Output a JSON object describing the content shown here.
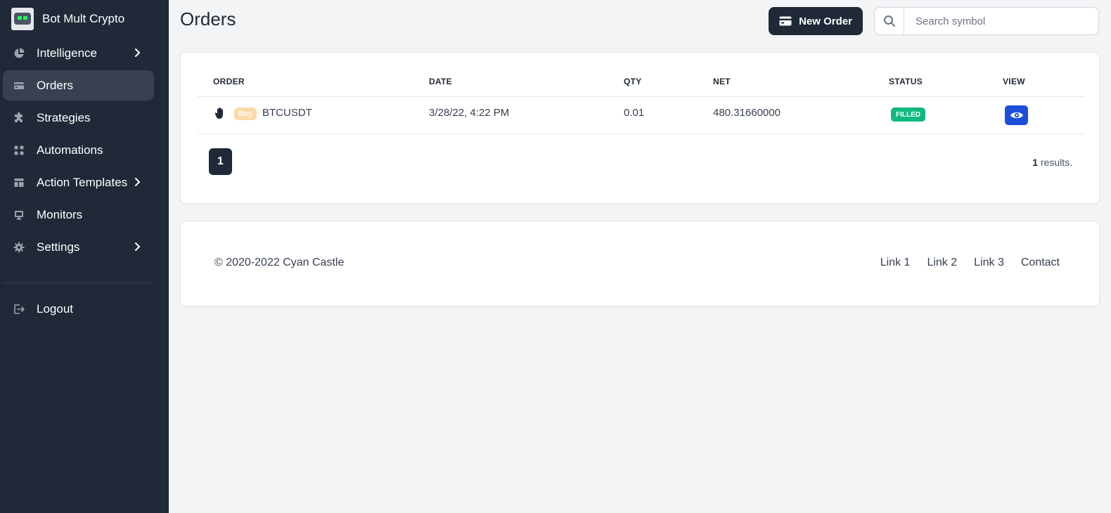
{
  "app": {
    "title": "Bot Mult Crypto"
  },
  "sidebar": {
    "items": [
      {
        "label": "Intelligence",
        "icon": "pie-chart-icon",
        "has_submenu": true,
        "active": false
      },
      {
        "label": "Orders",
        "icon": "credit-card-icon",
        "has_submenu": false,
        "active": true
      },
      {
        "label": "Strategies",
        "icon": "puzzle-icon",
        "has_submenu": false,
        "active": false
      },
      {
        "label": "Automations",
        "icon": "grid-icon",
        "has_submenu": false,
        "active": false
      },
      {
        "label": "Action Templates",
        "icon": "template-icon",
        "has_submenu": true,
        "active": false
      },
      {
        "label": "Monitors",
        "icon": "desktop-icon",
        "has_submenu": false,
        "active": false
      },
      {
        "label": "Settings",
        "icon": "gear-icon",
        "has_submenu": true,
        "active": false
      }
    ],
    "logout_label": "Logout"
  },
  "header": {
    "title": "Orders",
    "new_order_label": "New Order",
    "search_placeholder": "Search symbol",
    "search_value": ""
  },
  "orders_table": {
    "columns": [
      "ORDER",
      "DATE",
      "QTY",
      "NET",
      "STATUS",
      "VIEW"
    ],
    "rows": [
      {
        "side": "Buy",
        "symbol": "BTCUSDT",
        "date": "3/28/22, 4:22 PM",
        "qty": "0.01",
        "net": "480.31660000",
        "status": "FILLED"
      }
    ]
  },
  "pagination": {
    "current_page": "1",
    "results_count": "1",
    "results_suffix": " results."
  },
  "footer": {
    "copyright": "© 2020-2022 Cyan Castle",
    "links": [
      "Link 1",
      "Link 2",
      "Link 3",
      "Contact"
    ]
  },
  "colors": {
    "sidebar_bg": "#1f2937",
    "active_item_bg": "#374151",
    "page_bg": "#f3f4f6",
    "buy_badge": "#fcd9a8",
    "filled_badge": "#10b981",
    "view_button": "#1d4ed8"
  }
}
